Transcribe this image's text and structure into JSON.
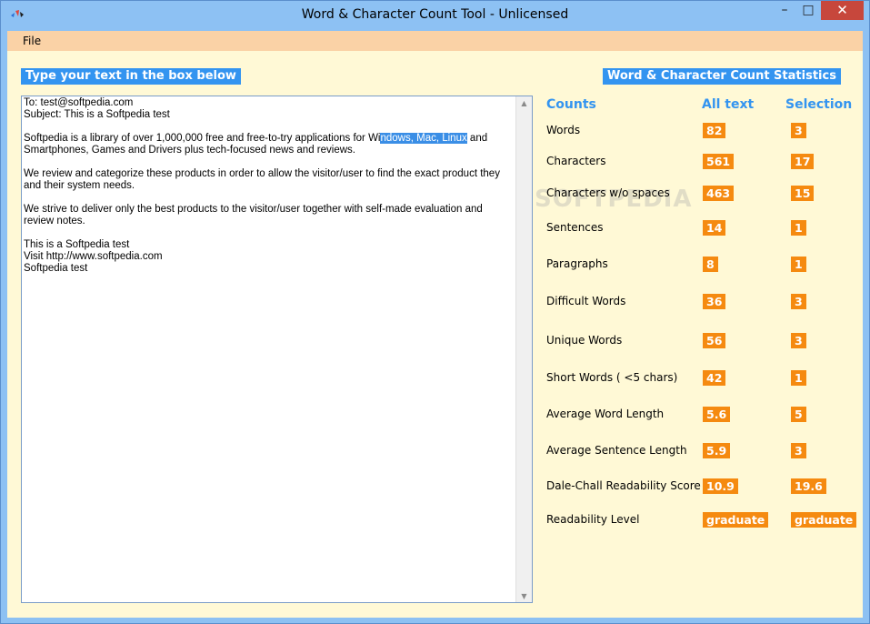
{
  "window": {
    "title": "Word & Character Count Tool - Unlicensed",
    "controls": {
      "minimize": "–",
      "maximize": "□",
      "close": "✕"
    }
  },
  "menu": {
    "file": "File"
  },
  "left_header": "Type your text in the box below",
  "right_header": "Word & Character Count Statistics",
  "editor": {
    "line1": "To: test@softpedia.com",
    "line2": "Subject: This is a Softpedia test",
    "p1_before": "Softpedia is a library of over 1,000,000 free and free-to-try applications for Wi",
    "p1_selected": "ndows, Mac, Linux",
    "p1_after": " and Smartphones, Games and Drivers plus tech-focused news and reviews.",
    "p2": "We review and categorize these products in order to allow the visitor/user to find the exact product they and their system needs.",
    "p3": "We strive to deliver only the best products to the visitor/user together with self-made evaluation and review notes.",
    "p4_line1": "This is a Softpedia test",
    "p4_line2": "Visit http://www.softpedia.com",
    "p4_line3": "Softpedia test"
  },
  "stats": {
    "col_counts": "Counts",
    "col_all": "All text",
    "col_selection": "Selection",
    "rows": [
      {
        "label": "Words",
        "all": "82",
        "sel": "3"
      },
      {
        "label": "Characters",
        "all": "561",
        "sel": "17"
      },
      {
        "label": "Characters w/o spaces",
        "all": "463",
        "sel": "15"
      },
      {
        "label": "Sentences",
        "all": "14",
        "sel": "1"
      },
      {
        "label": "Paragraphs",
        "all": "8",
        "sel": "1"
      },
      {
        "label": "Difficult Words",
        "all": "36",
        "sel": "3"
      },
      {
        "label": "Unique Words",
        "all": "56",
        "sel": "3"
      },
      {
        "label": "Short Words ( <5 chars)",
        "all": "42",
        "sel": "1"
      },
      {
        "label": "Average Word Length",
        "all": "5.6",
        "sel": "5"
      },
      {
        "label": "Average Sentence Length",
        "all": "5.9",
        "sel": "3"
      },
      {
        "label": "Dale-Chall Readability Score",
        "all": "10.9",
        "sel": "19.6"
      },
      {
        "label": "Readability Level",
        "all": "graduate",
        "sel": "graduate"
      }
    ]
  },
  "watermark": "SOFTPEDIA",
  "colors": {
    "header_bg": "#3394f0",
    "value_bg": "#f58a10",
    "panel_bg": "#fff9d6",
    "menu_bg": "#fad2a6"
  }
}
